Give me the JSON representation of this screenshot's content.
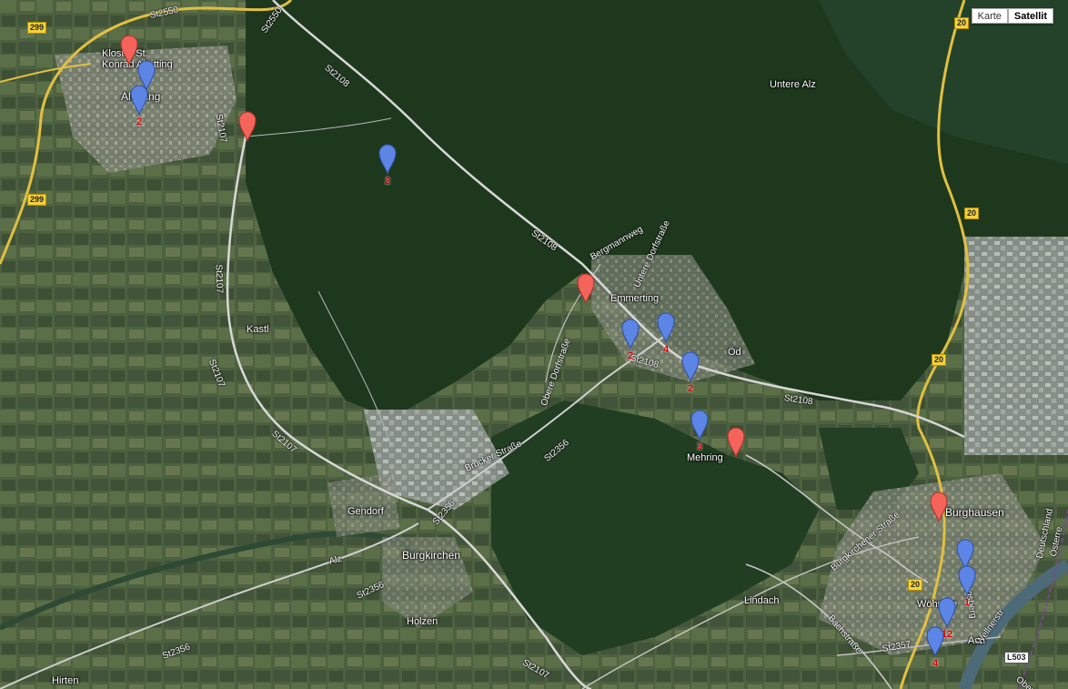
{
  "map_type_control": {
    "map_label": "Karte",
    "satellite_label": "Satellit",
    "active": "satellite"
  },
  "place_labels": {
    "kloster_line1": "Kloster St.",
    "kloster_line2": "Konrad Altötting",
    "altoetting": "Altötting",
    "untere_alz": "Untere Alz",
    "kastl": "Kastl",
    "emmerting": "Emmerting",
    "oed": "Öd",
    "mehring": "Mehring",
    "gendorf": "Gendorf",
    "burgkirchen": "Burgkirchen",
    "holzen": "Holzen",
    "lindach": "Lindach",
    "burghausen": "Burghausen",
    "hirten": "Hirten",
    "woehrsee": "Wöhrsee",
    "ach": "Ach",
    "oberin": "Oberin",
    "deutschland": "Deutschland",
    "oesterreich": "Österre",
    "alz": "Alz"
  },
  "road_labels": {
    "st2550": "St2550",
    "st2108_a": "St2108",
    "st2108_b": "St2108",
    "st2108_c": "St2108",
    "st2108_d": "St2108",
    "st2107_a": "St2107",
    "st2107_b": "St2107",
    "st2107_c": "St2107",
    "st2107_d": "St2107",
    "st2356_a": "St2356",
    "st2356_b": "St2356",
    "st2356_c": "St2356",
    "st2356_d": "St2356",
    "st2357": "St2357",
    "bergmannweg": "Bergmannweg",
    "untere_dorfstrasse": "Untere Dorfstraße",
    "obere_dorfstrasse": "Obere Dorfstraße",
    "brucker_strasse": "Brucker Straße",
    "burgkirchener_strasse": "Burgkirchener Straße",
    "bachstrasse": "Bachstraße",
    "ludwigsberg": "Ludwigsberg",
    "wellnerstr": "Wellnerstr"
  },
  "shields": {
    "b299_top": "299",
    "b299_bottom": "299",
    "b20_top": "20",
    "b20_mid": "20",
    "b20_low": "20",
    "b20_bottom": "20",
    "l503": "L503"
  },
  "markers": [
    {
      "color": "red",
      "count": ""
    },
    {
      "color": "blue",
      "count": ""
    },
    {
      "color": "blue",
      "count": "2"
    },
    {
      "color": "red",
      "count": ""
    },
    {
      "color": "blue",
      "count": "2"
    },
    {
      "color": "red",
      "count": ""
    },
    {
      "color": "blue",
      "count": "2"
    },
    {
      "color": "blue",
      "count": "4"
    },
    {
      "color": "blue",
      "count": "2"
    },
    {
      "color": "blue",
      "count": "3"
    },
    {
      "color": "red",
      "count": ""
    },
    {
      "color": "red",
      "count": ""
    },
    {
      "color": "blue",
      "count": ""
    },
    {
      "color": "blue",
      "count": "1"
    },
    {
      "color": "blue",
      "count": "12"
    },
    {
      "color": "blue",
      "count": "4"
    }
  ],
  "colors": {
    "marker_red": "#f4645a",
    "marker_blue": "#5c85e6",
    "count_text": "#d40000",
    "forest": "#1f3a1f",
    "fields": "#4a5e3a"
  }
}
